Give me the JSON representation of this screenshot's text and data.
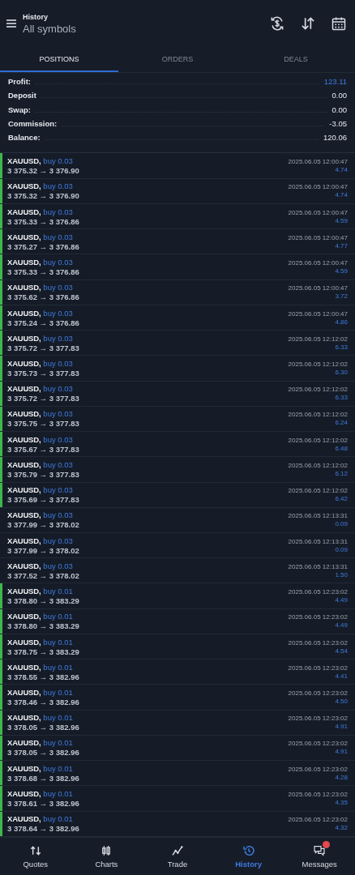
{
  "header": {
    "subtitle": "History",
    "title": "All symbols"
  },
  "tabs": [
    {
      "label": "POSITIONS",
      "selected": true
    },
    {
      "label": "ORDERS",
      "selected": false
    },
    {
      "label": "DEALS",
      "selected": false
    }
  ],
  "summary": [
    {
      "label": "Profit:",
      "value": "123.11",
      "kind": "accent"
    },
    {
      "label": "Deposit",
      "value": "0.00",
      "kind": "plain"
    },
    {
      "label": "Swap:",
      "value": "0.00",
      "kind": "plain"
    },
    {
      "label": "Commission:",
      "value": "-3.05",
      "kind": "plain"
    },
    {
      "label": "Balance:",
      "value": "120.06",
      "kind": "plain"
    }
  ],
  "positions": [
    {
      "symbol": "XAUUSD,",
      "side": "buy 0.03",
      "prices": "3 375.32 → 3 376.90",
      "time": "2025.06.05 12:00:47",
      "profit": "4.74",
      "highlighted": true
    },
    {
      "symbol": "XAUUSD,",
      "side": "buy 0.03",
      "prices": "3 375.32 → 3 376.90",
      "time": "2025.06.05 12:00:47",
      "profit": "4.74",
      "highlighted": true
    },
    {
      "symbol": "XAUUSD,",
      "side": "buy 0.03",
      "prices": "3 375.33 → 3 376.86",
      "time": "2025.06.05 12:00:47",
      "profit": "4.59",
      "highlighted": true
    },
    {
      "symbol": "XAUUSD,",
      "side": "buy 0.03",
      "prices": "3 375.27 → 3 376.86",
      "time": "2025.06.05 12:00:47",
      "profit": "4.77",
      "highlighted": true
    },
    {
      "symbol": "XAUUSD,",
      "side": "buy 0.03",
      "prices": "3 375.33 → 3 376.86",
      "time": "2025.06.05 12:00:47",
      "profit": "4.59",
      "highlighted": true
    },
    {
      "symbol": "XAUUSD,",
      "side": "buy 0.03",
      "prices": "3 375.62 → 3 376.86",
      "time": "2025.06.05 12:00:47",
      "profit": "3.72",
      "highlighted": true
    },
    {
      "symbol": "XAUUSD,",
      "side": "buy 0.03",
      "prices": "3 375.24 → 3 376.86",
      "time": "2025.06.05 12:00:47",
      "profit": "4.86",
      "highlighted": true
    },
    {
      "symbol": "XAUUSD,",
      "side": "buy 0.03",
      "prices": "3 375.72 → 3 377.83",
      "time": "2025.06.05 12:12:02",
      "profit": "6.33",
      "highlighted": true
    },
    {
      "symbol": "XAUUSD,",
      "side": "buy 0.03",
      "prices": "3 375.73 → 3 377.83",
      "time": "2025.06.05 12:12:02",
      "profit": "6.30",
      "highlighted": true
    },
    {
      "symbol": "XAUUSD,",
      "side": "buy 0.03",
      "prices": "3 375.72 → 3 377.83",
      "time": "2025.06.05 12:12:02",
      "profit": "6.33",
      "highlighted": true
    },
    {
      "symbol": "XAUUSD,",
      "side": "buy 0.03",
      "prices": "3 375.75 → 3 377.83",
      "time": "2025.06.05 12:12:02",
      "profit": "6.24",
      "highlighted": true
    },
    {
      "symbol": "XAUUSD,",
      "side": "buy 0.03",
      "prices": "3 375.67 → 3 377.83",
      "time": "2025.06.05 12:12:02",
      "profit": "6.48",
      "highlighted": true
    },
    {
      "symbol": "XAUUSD,",
      "side": "buy 0.03",
      "prices": "3 375.79 → 3 377.83",
      "time": "2025.06.05 12:12:02",
      "profit": "6.12",
      "highlighted": true
    },
    {
      "symbol": "XAUUSD,",
      "side": "buy 0.03",
      "prices": "3 375.69 → 3 377.83",
      "time": "2025.06.05 12:12:02",
      "profit": "6.42",
      "highlighted": true
    },
    {
      "symbol": "XAUUSD,",
      "side": "buy 0.03",
      "prices": "3 377.99 → 3 378.02",
      "time": "2025.06.05 12:13:31",
      "profit": "0.09",
      "highlighted": false
    },
    {
      "symbol": "XAUUSD,",
      "side": "buy 0.03",
      "prices": "3 377.99 → 3 378.02",
      "time": "2025.06.05 12:13:31",
      "profit": "0.09",
      "highlighted": false
    },
    {
      "symbol": "XAUUSD,",
      "side": "buy 0.03",
      "prices": "3 377.52 → 3 378.02",
      "time": "2025.06.05 12:13:31",
      "profit": "1.50",
      "highlighted": false
    },
    {
      "symbol": "XAUUSD,",
      "side": "buy 0.01",
      "prices": "3 378.80 → 3 383.29",
      "time": "2025.06.05 12:23:02",
      "profit": "4.49",
      "highlighted": true
    },
    {
      "symbol": "XAUUSD,",
      "side": "buy 0.01",
      "prices": "3 378.80 → 3 383.29",
      "time": "2025.06.05 12:23:02",
      "profit": "4.49",
      "highlighted": true
    },
    {
      "symbol": "XAUUSD,",
      "side": "buy 0.01",
      "prices": "3 378.75 → 3 383.29",
      "time": "2025.06.05 12:23:02",
      "profit": "4.54",
      "highlighted": true
    },
    {
      "symbol": "XAUUSD,",
      "side": "buy 0.01",
      "prices": "3 378.55 → 3 382.96",
      "time": "2025.06.05 12:23:02",
      "profit": "4.41",
      "highlighted": true
    },
    {
      "symbol": "XAUUSD,",
      "side": "buy 0.01",
      "prices": "3 378.46 → 3 382.96",
      "time": "2025.06.05 12:23:02",
      "profit": "4.50",
      "highlighted": true
    },
    {
      "symbol": "XAUUSD,",
      "side": "buy 0.01",
      "prices": "3 378.05 → 3 382.96",
      "time": "2025.06.05 12:23:02",
      "profit": "4.91",
      "highlighted": true
    },
    {
      "symbol": "XAUUSD,",
      "side": "buy 0.01",
      "prices": "3 378.05 → 3 382.96",
      "time": "2025.06.05 12:23:02",
      "profit": "4.91",
      "highlighted": true
    },
    {
      "symbol": "XAUUSD,",
      "side": "buy 0.01",
      "prices": "3 378.68 → 3 382.96",
      "time": "2025.06.05 12:23:02",
      "profit": "4.28",
      "highlighted": true
    },
    {
      "symbol": "XAUUSD,",
      "side": "buy 0.01",
      "prices": "3 378.61 → 3 382.96",
      "time": "2025.06.05 12:23:02",
      "profit": "4.35",
      "highlighted": true
    },
    {
      "symbol": "XAUUSD,",
      "side": "buy 0.01",
      "prices": "3 378.64 → 3 382.96",
      "time": "2025.06.05 12:23:02",
      "profit": "4.32",
      "highlighted": true
    }
  ],
  "nav": [
    {
      "label": "Quotes",
      "kind": "quotes",
      "selected": false,
      "badge": false
    },
    {
      "label": "Charts",
      "kind": "charts",
      "selected": false,
      "badge": false
    },
    {
      "label": "Trade",
      "kind": "trade",
      "selected": false,
      "badge": false
    },
    {
      "label": "History",
      "kind": "history",
      "selected": true,
      "badge": false
    },
    {
      "label": "Messages",
      "kind": "messages",
      "selected": false,
      "badge": true
    }
  ]
}
